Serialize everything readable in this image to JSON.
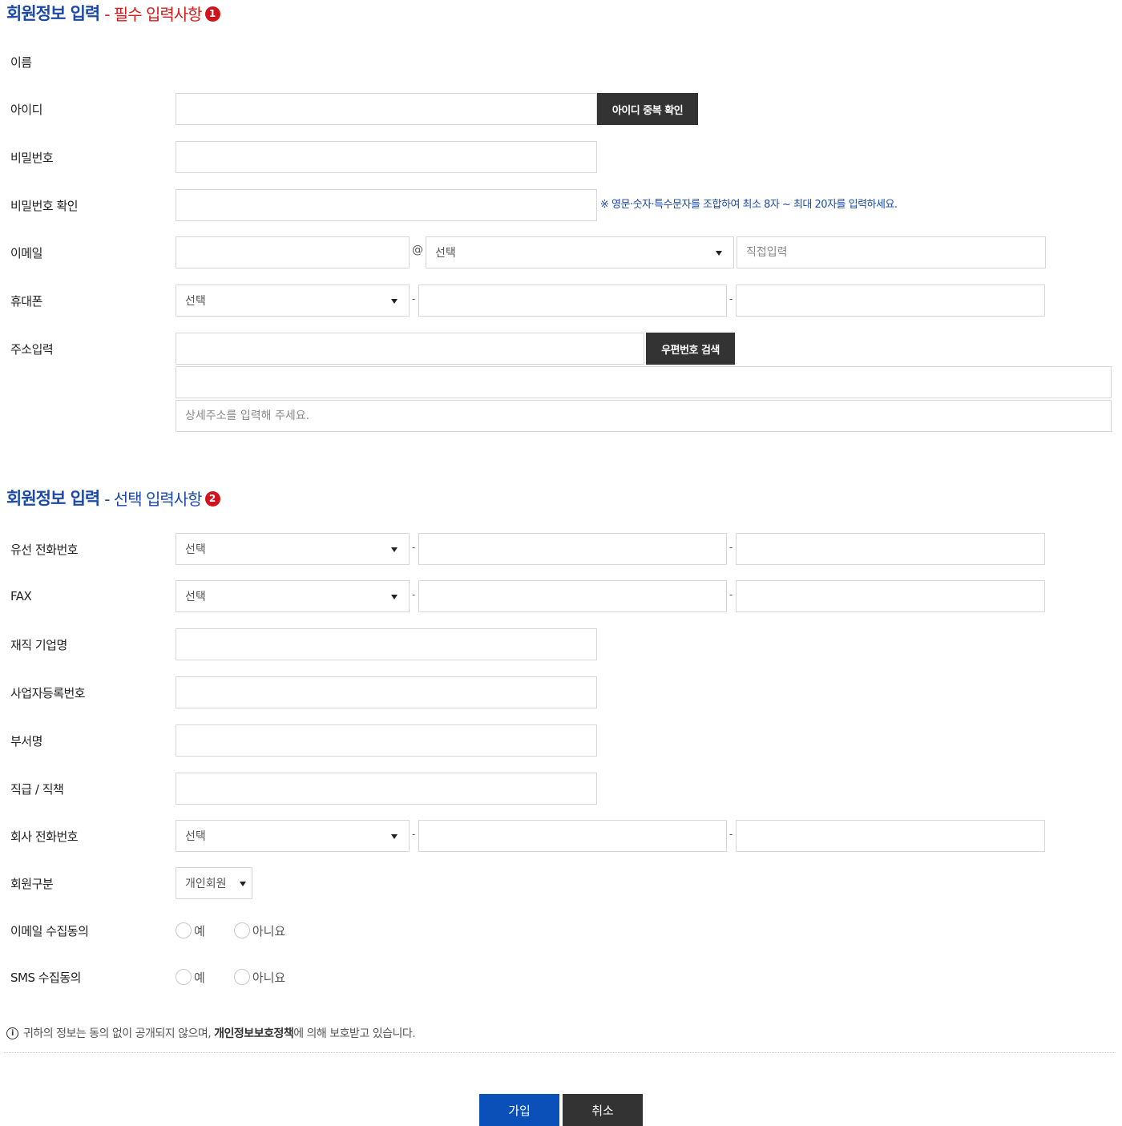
{
  "required_section": {
    "title": "회원정보 입력",
    "subtitle": "- 필수 입력사항",
    "badge": "1",
    "fields": {
      "name_label": "이름",
      "id_label": "아이디",
      "id_check_button": "아이디 중복 확인",
      "password_label": "비밀번호",
      "password_confirm_label": "비밀번호 확인",
      "password_hint": "※ 영문·숫자·특수문자를 조합하여 최소 8자 ~ 최대 20자를 입력하세요.",
      "email_label": "이메일",
      "email_at": "@",
      "email_domain_select": "선택",
      "email_direct_placeholder": "직접입력",
      "mobile_label": "휴대폰",
      "mobile_select": "선택",
      "address_label": "주소입력",
      "zipcode_button": "우편번호 검색",
      "address_detail_placeholder": "상세주소를 입력해 주세요."
    }
  },
  "optional_section": {
    "title": "회원정보 입력",
    "subtitle": "- 선택 입력사항",
    "badge": "2",
    "fields": {
      "landline_label": "유선 전화번호",
      "landline_select": "선택",
      "fax_label": "FAX",
      "fax_select": "선택",
      "company_label": "재직 기업명",
      "business_no_label": "사업자등록번호",
      "department_label": "부서명",
      "position_label": "직급 / 직책",
      "company_phone_label": "회사 전화번호",
      "company_phone_select": "선택",
      "member_type_label": "회원구분",
      "member_type_select": "개인회원",
      "email_consent_label": "이메일 수집동의",
      "sms_consent_label": "SMS 수집동의",
      "yes": "예",
      "no": "아니요"
    }
  },
  "dash": "-",
  "notice": {
    "icon": "info-icon",
    "icon_glyph": "i",
    "text_before": "귀하의 정보는 동의 없이 공개되지 않으며,",
    "policy_link": "개인정보보호정책",
    "text_after": "에 의해 보호받고 있습니다."
  },
  "buttons": {
    "join": "가입",
    "cancel": "취소"
  },
  "colors": {
    "title_blue": "#1a49a8",
    "required_red": "#d71a1a",
    "primary_button": "#0b4fb8",
    "dark_button": "#333333"
  }
}
